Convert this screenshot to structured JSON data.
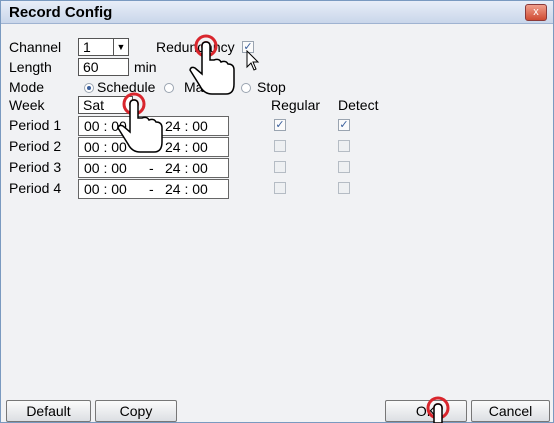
{
  "window": {
    "title": "Record Config",
    "close_label": "x"
  },
  "channel": {
    "label": "Channel",
    "value": "1",
    "arrow": "▼"
  },
  "redundancy": {
    "label": "Redundancy",
    "checked": true
  },
  "length": {
    "label": "Length",
    "value": "60",
    "unit": "min"
  },
  "mode": {
    "label": "Mode",
    "options": [
      "Schedule",
      "Manual",
      "Stop"
    ],
    "selected": "Schedule"
  },
  "week": {
    "label": "Week",
    "value": "Sat"
  },
  "columns": {
    "regular": "Regular",
    "detect": "Detect"
  },
  "periods": [
    {
      "label": "Period 1",
      "start": "00 : 00",
      "sep": "-",
      "end": "24 : 00",
      "regular": true,
      "detect": true
    },
    {
      "label": "Period 2",
      "start": "00 : 00",
      "sep": "-",
      "end": "24 : 00",
      "regular": false,
      "detect": false
    },
    {
      "label": "Period 3",
      "start": "00 : 00",
      "sep": "-",
      "end": "24 : 00",
      "regular": false,
      "detect": false
    },
    {
      "label": "Period 4",
      "start": "00 : 00",
      "sep": "-",
      "end": "24 : 00",
      "regular": false,
      "detect": false
    }
  ],
  "buttons": {
    "default": "Default",
    "copy": "Copy",
    "ok": "OK",
    "cancel": "Cancel"
  },
  "check_glyph": "✓"
}
